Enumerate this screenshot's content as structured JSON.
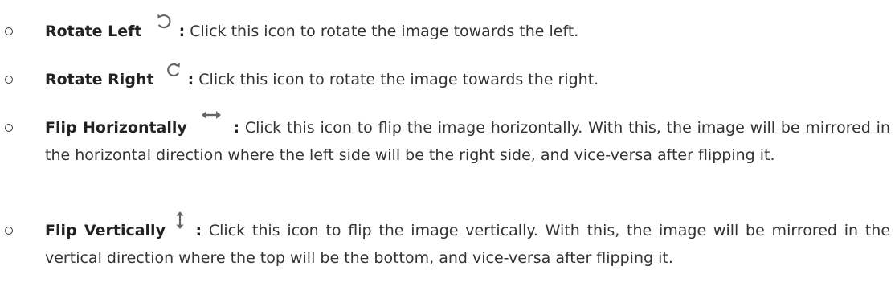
{
  "items": [
    {
      "title": "Rotate Left",
      "icon": "rotate-left-icon",
      "colon": ":",
      "description": "Click this icon to rotate the image towards the left."
    },
    {
      "title": "Rotate Right",
      "icon": "rotate-right-icon",
      "colon": ":",
      "description": "Click this icon to rotate the image towards the right."
    },
    {
      "title": "Flip Horizontally",
      "icon": "flip-horizontal-icon",
      "colon": ":",
      "description": "Click this icon to flip the image horizontally. With this, the image will be mirrored in the horizontal direction where the left side will be the right side, and vice-versa after flipping it."
    },
    {
      "title": "Flip Vertically",
      "icon": "flip-vertical-icon",
      "colon": ":",
      "description": "Click this icon to flip the image vertically. With this, the image will be mirrored in the vertical direction where the top will be the bottom, and vice-versa after flipping it."
    }
  ],
  "colors": {
    "text": "#333333",
    "icon": "#666666"
  }
}
